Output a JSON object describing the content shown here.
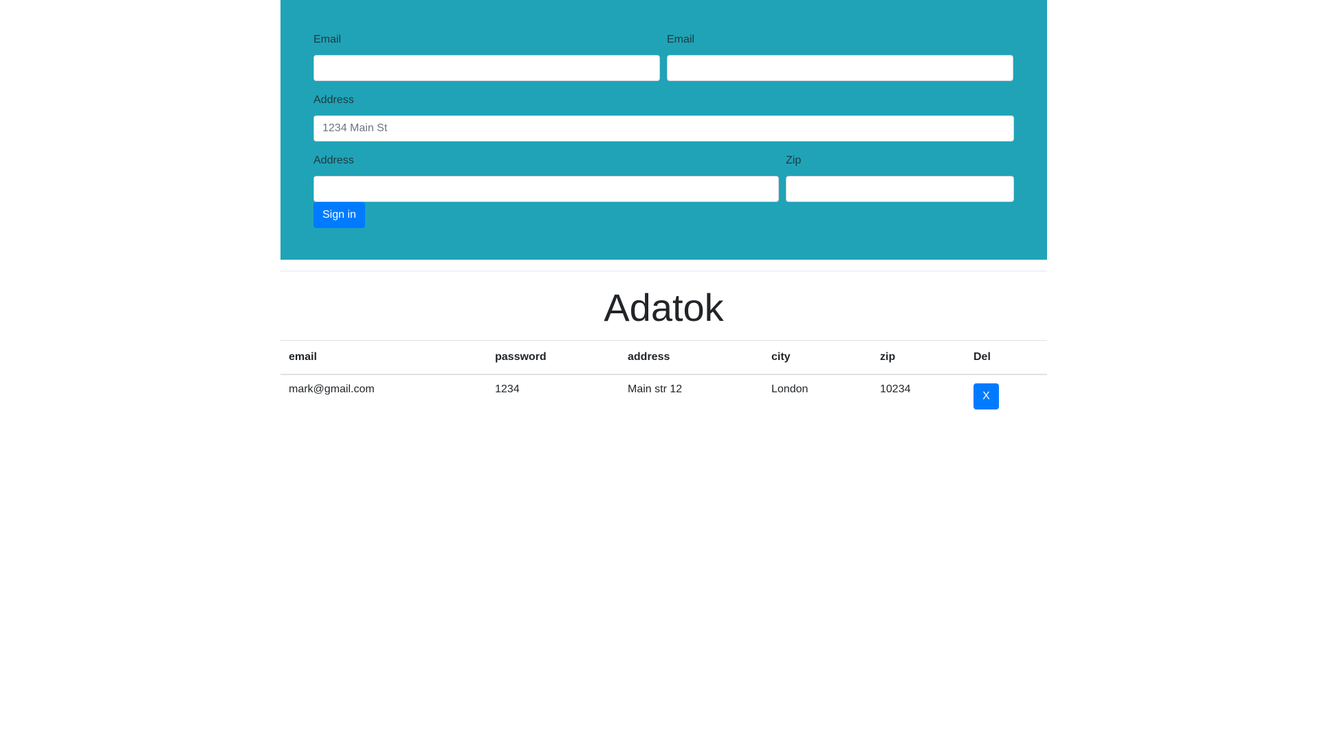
{
  "form": {
    "email1_label": "Email",
    "email1_value": "",
    "email2_label": "Email",
    "email2_value": "",
    "address_label": "Address",
    "address_placeholder": "1234 Main St",
    "address2_label": "Address",
    "address2_value": "",
    "zip_label": "Zip",
    "zip_value": "",
    "submit_label": "Sign in"
  },
  "page_title": "Adatok",
  "table": {
    "headers": [
      "email",
      "password",
      "address",
      "city",
      "zip",
      "Del"
    ],
    "rows": [
      {
        "email": "mark@gmail.com",
        "password": "1234",
        "address": "Main str 12",
        "city": "London",
        "zip": "10234",
        "delete_label": "X"
      }
    ]
  },
  "colors": {
    "panel_background": "#20a3b7",
    "primary_button": "#007bff"
  }
}
